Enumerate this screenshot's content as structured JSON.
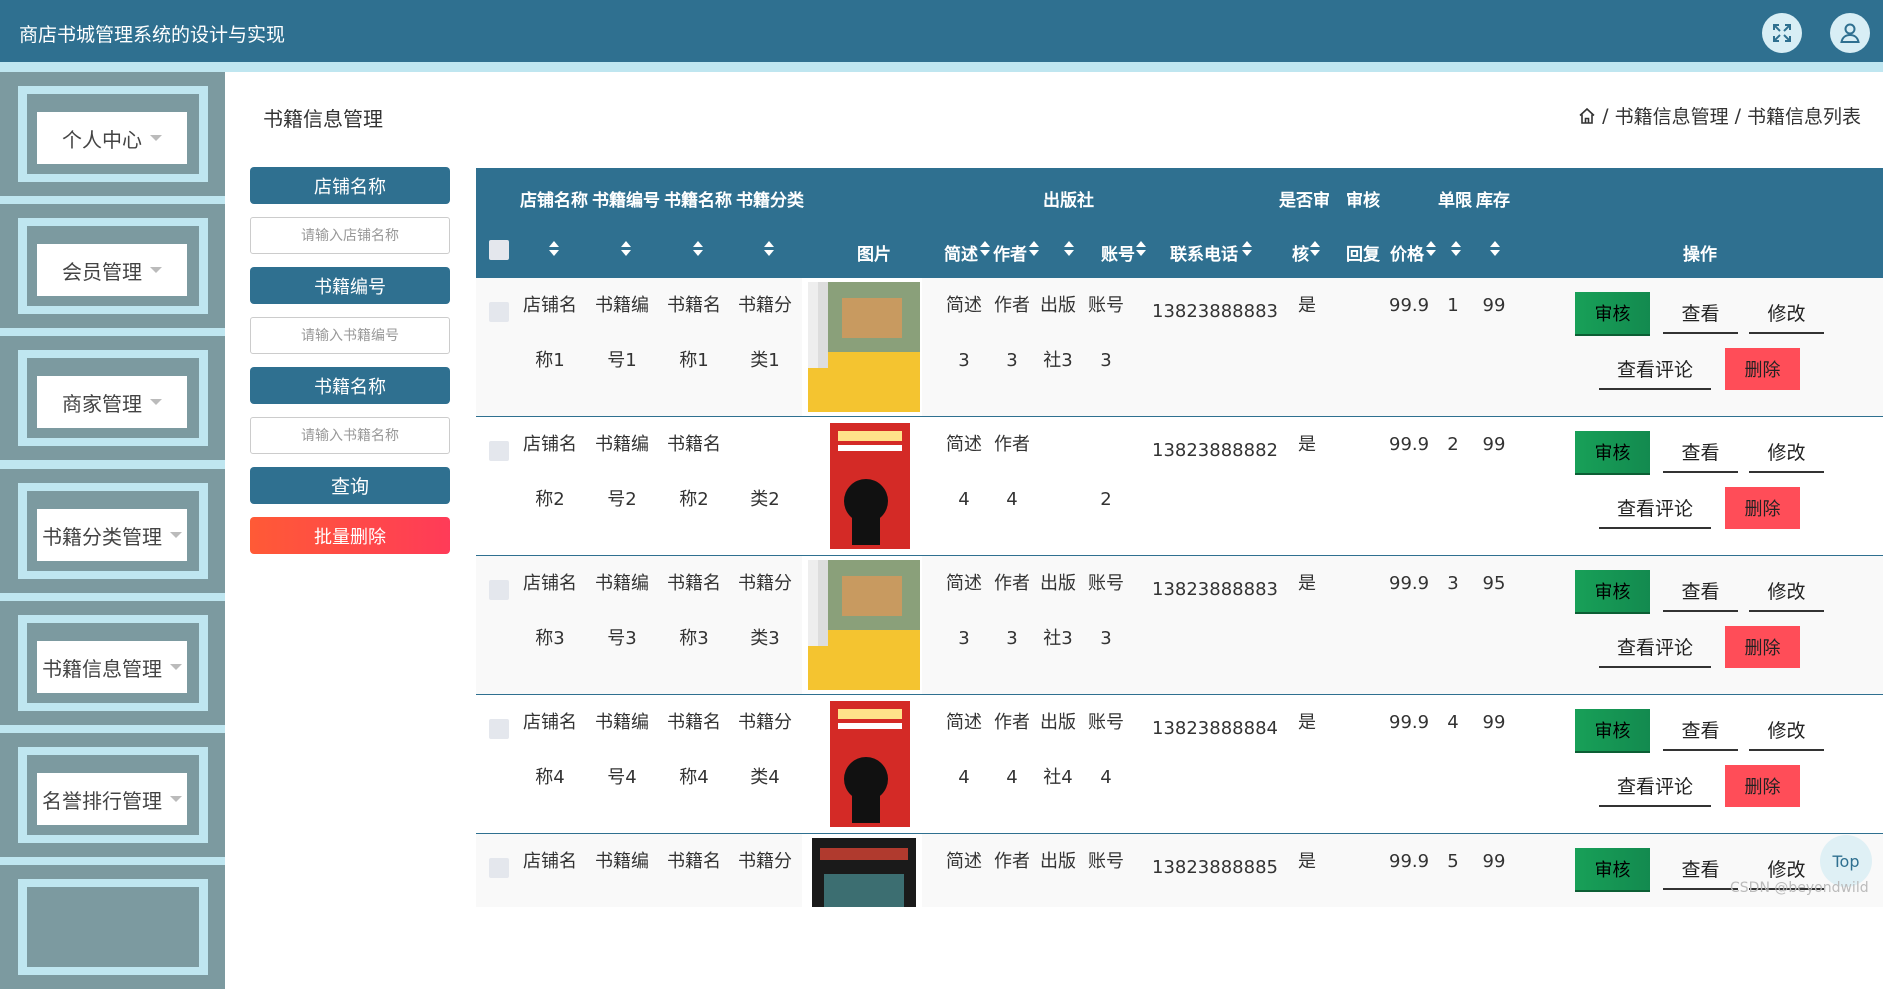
{
  "app": {
    "title": "商店书城管理系统的设计与实现"
  },
  "header": {
    "fullscreen_icon": "expand-icon",
    "user_icon": "user-icon"
  },
  "sidebar": {
    "items": [
      {
        "label": "个人中心"
      },
      {
        "label": "会员管理"
      },
      {
        "label": "商家管理"
      },
      {
        "label": "书籍分类管理"
      },
      {
        "label": "书籍信息管理"
      },
      {
        "label": "名誉排行管理"
      }
    ]
  },
  "page": {
    "title": "书籍信息管理"
  },
  "breadcrumb": {
    "home_icon": "home-icon",
    "items": [
      "书籍信息管理",
      "书籍信息列表"
    ],
    "separator": "/"
  },
  "search": {
    "shop_label": "店铺名称",
    "shop_placeholder": "请输入店铺名称",
    "code_label": "书籍编号",
    "code_placeholder": "请输入书籍编号",
    "name_label": "书籍名称",
    "name_placeholder": "请输入书籍名称",
    "query_button": "查询",
    "batch_delete_button": "批量删除"
  },
  "table": {
    "headers": {
      "shop": "店铺名称",
      "code": "书籍编号",
      "name": "书籍名称",
      "category": "书籍分类",
      "image": "图片",
      "desc": "简述",
      "author": "作者",
      "publisher": "出版社",
      "account": "账号",
      "phone": "联系电话",
      "audit_top": "是否审",
      "audit_bottom": "核",
      "reply_top": "审核",
      "reply_bottom": "回复",
      "price": "价格",
      "limit": "单限",
      "stock": "库存",
      "ops": "操作"
    },
    "rows": [
      {
        "shop": [
          "店铺名",
          "称1"
        ],
        "code": [
          "书籍编",
          "号1"
        ],
        "name": [
          "书籍名",
          "称1"
        ],
        "category": [
          "书籍分",
          "类1"
        ],
        "cover": "yellow",
        "desc": [
          "简述",
          "3"
        ],
        "author": [
          "作者",
          "3"
        ],
        "publisher": [
          "出版",
          "社3"
        ],
        "account": [
          "账号",
          "3"
        ],
        "phone": "13823888883",
        "audit": "是",
        "price": "99.9",
        "limit": "1",
        "stock": "99"
      },
      {
        "shop": [
          "店铺名",
          "称2"
        ],
        "code": [
          "书籍编",
          "号2"
        ],
        "name": [
          "书籍名",
          "称2"
        ],
        "category": [
          "",
          "类2"
        ],
        "cover": "red",
        "desc": [
          "简述",
          "4"
        ],
        "author": [
          "作者",
          "4"
        ],
        "publisher": [
          "",
          ""
        ],
        "account": [
          "",
          "2"
        ],
        "phone": "13823888882",
        "audit": "是",
        "price": "99.9",
        "limit": "2",
        "stock": "99"
      },
      {
        "shop": [
          "店铺名",
          "称3"
        ],
        "code": [
          "书籍编",
          "号3"
        ],
        "name": [
          "书籍名",
          "称3"
        ],
        "category": [
          "书籍分",
          "类3"
        ],
        "cover": "yellow",
        "desc": [
          "简述",
          "3"
        ],
        "author": [
          "作者",
          "3"
        ],
        "publisher": [
          "出版",
          "社3"
        ],
        "account": [
          "账号",
          "3"
        ],
        "phone": "13823888883",
        "audit": "是",
        "price": "99.9",
        "limit": "3",
        "stock": "95"
      },
      {
        "shop": [
          "店铺名",
          "称4"
        ],
        "code": [
          "书籍编",
          "号4"
        ],
        "name": [
          "书籍名",
          "称4"
        ],
        "category": [
          "书籍分",
          "类4"
        ],
        "cover": "red",
        "desc": [
          "简述",
          "4"
        ],
        "author": [
          "作者",
          "4"
        ],
        "publisher": [
          "出版",
          "社4"
        ],
        "account": [
          "账号",
          "4"
        ],
        "phone": "13823888884",
        "audit": "是",
        "price": "99.9",
        "limit": "4",
        "stock": "99"
      },
      {
        "shop": [
          "店铺名",
          ""
        ],
        "code": [
          "书籍编",
          ""
        ],
        "name": [
          "书籍名",
          ""
        ],
        "category": [
          "书籍分",
          ""
        ],
        "cover": "dark",
        "desc": [
          "简述",
          ""
        ],
        "author": [
          "作者",
          ""
        ],
        "publisher": [
          "出版",
          ""
        ],
        "account": [
          "账号",
          ""
        ],
        "phone": "13823888885",
        "audit": "是",
        "price": "99.9",
        "limit": "5",
        "stock": "99"
      }
    ],
    "actions": {
      "audit": "审核",
      "view": "查看",
      "edit": "修改",
      "comments": "查看评论",
      "delete": "删除"
    }
  },
  "top_button": "Top",
  "watermark": "CSDN @beyondwild",
  "colors": {
    "primary": "#2f7090",
    "sidebar_bg": "#bfe6f0",
    "audit_green": "#18a058",
    "danger": "#ff4d58"
  }
}
